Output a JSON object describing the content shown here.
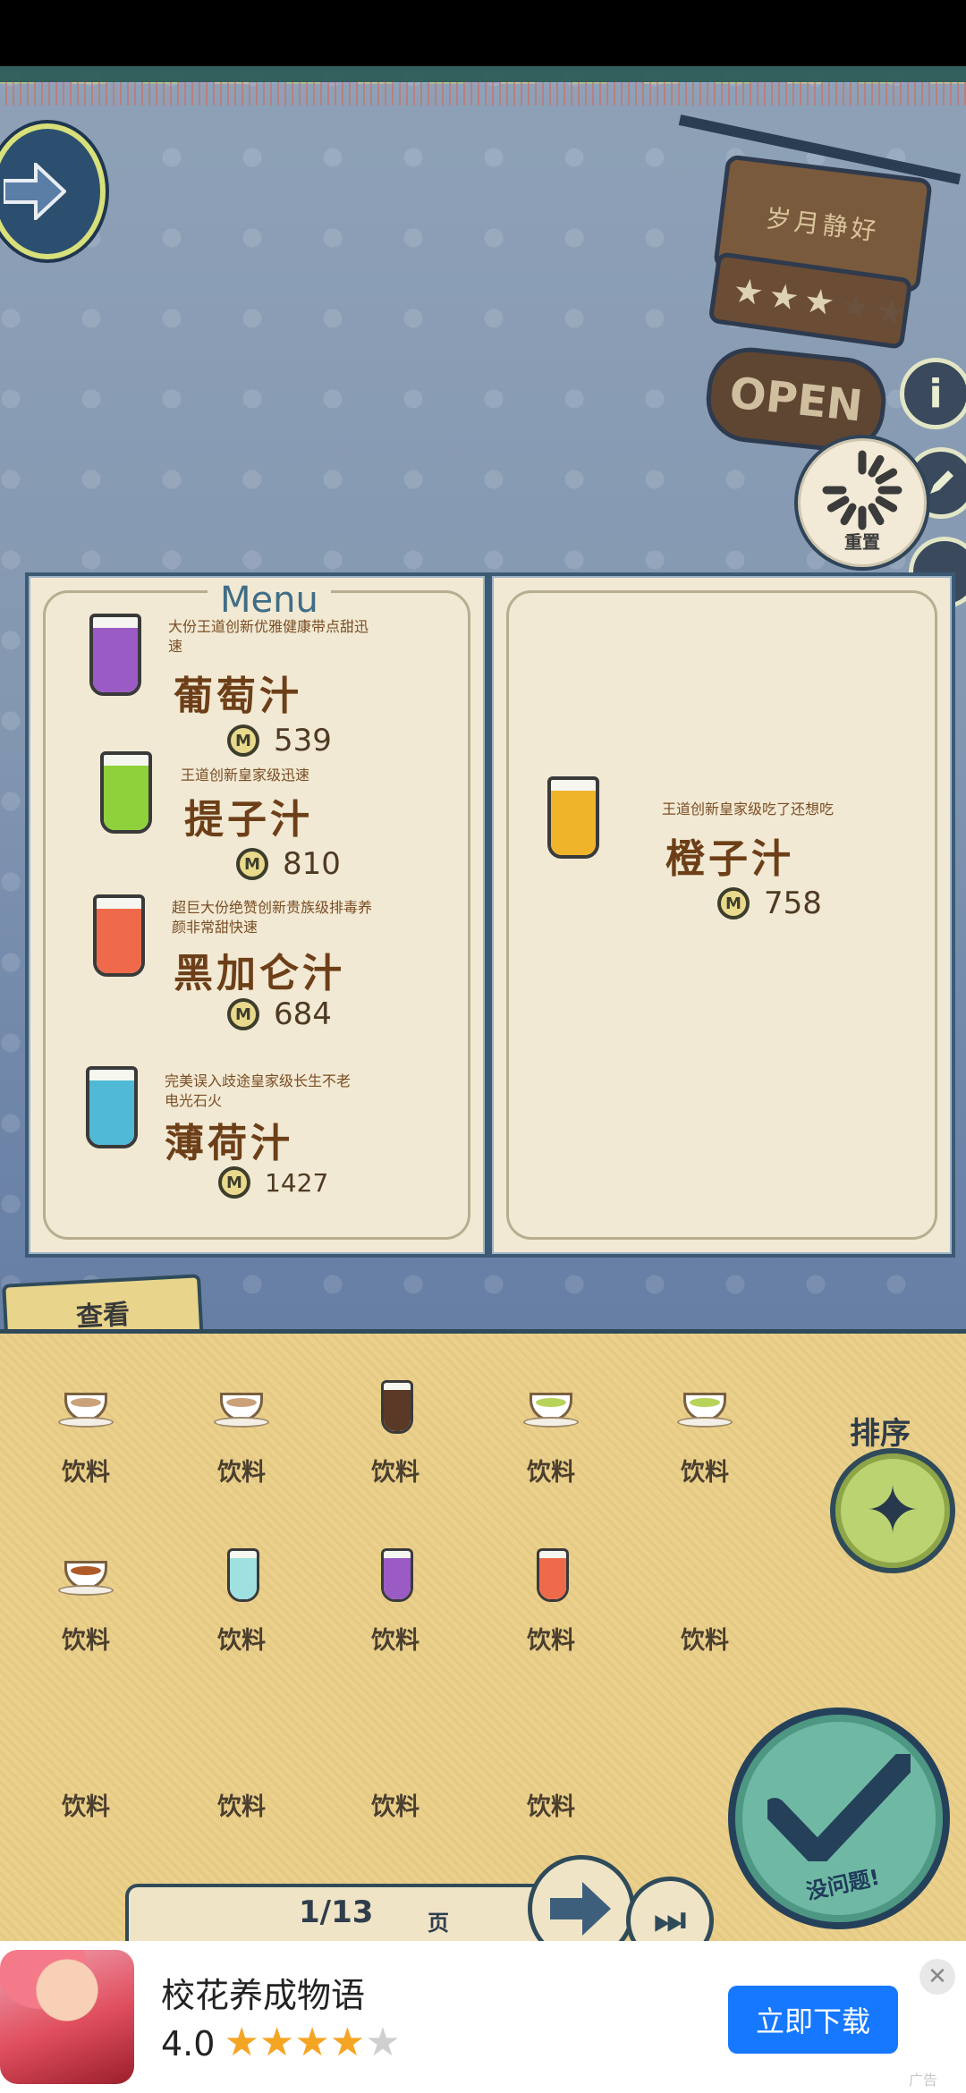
{
  "shop_sign": {
    "name": "岁月静好",
    "stars_total": 5,
    "stars_lit": 3,
    "open_label": "OPEN"
  },
  "side_buttons": {
    "info": "i"
  },
  "reset": {
    "label": "重置"
  },
  "menu": {
    "title": "Menu",
    "items": [
      {
        "desc": "大份王道创新优雅健康带点甜迅速",
        "name": "葡萄汁",
        "price": "539",
        "color": "#9b5bc5"
      },
      {
        "desc": "王道创新皇家级迅速",
        "name": "提子汁",
        "price": "810",
        "color": "#8fd13a"
      },
      {
        "desc": "超巨大份绝赞创新贵族级排毒养颜非常甜快速",
        "name": "黑加仑汁",
        "price": "684",
        "color": "#ef6a4a"
      },
      {
        "desc": "完美误入歧途皇家级长生不老电光石火",
        "name": "薄荷汁",
        "price": "1427",
        "color": "#4fb9d6"
      },
      {
        "desc": "王道创新皇家级吃了还想吃",
        "name": "橙子汁",
        "price": "758",
        "color": "#f0b42a"
      }
    ]
  },
  "view_tab": {
    "label": "查看"
  },
  "inventory": {
    "rows": [
      [
        {
          "label": "饮料",
          "icon": "coffee-cup-icon",
          "color": "#caa27a"
        },
        {
          "label": "饮料",
          "icon": "coffee-cup-icon",
          "color": "#caa27a"
        },
        {
          "label": "饮料",
          "icon": "glass-icon",
          "color": "#5a3a26"
        },
        {
          "label": "饮料",
          "icon": "green-tea-cup-icon",
          "color": "#b7d35a"
        },
        {
          "label": "饮料",
          "icon": "green-tea-cup-icon",
          "color": "#b7d35a"
        }
      ],
      [
        {
          "label": "饮料",
          "icon": "tea-cup-icon",
          "color": "#b05a2a"
        },
        {
          "label": "饮料",
          "icon": "glass-icon",
          "color": "#9fe0e0"
        },
        {
          "label": "饮料",
          "icon": "glass-icon",
          "color": "#9b5bc5"
        },
        {
          "label": "饮料",
          "icon": "glass-icon",
          "color": "#ef6a4a"
        },
        {
          "label": "饮料",
          "icon": "",
          "color": ""
        }
      ],
      [
        {
          "label": "饮料",
          "icon": "",
          "color": ""
        },
        {
          "label": "饮料",
          "icon": "",
          "color": ""
        },
        {
          "label": "饮料",
          "icon": "",
          "color": ""
        },
        {
          "label": "饮料",
          "icon": "",
          "color": ""
        }
      ]
    ]
  },
  "sort": {
    "label": "排序"
  },
  "confirm": {
    "label": "没问题!"
  },
  "pager": {
    "text": "1/13",
    "unit": "页"
  },
  "ad": {
    "title": "校花养成物语",
    "rating": "4.0",
    "stars_lit": 4,
    "stars_total": 5,
    "button": "立即下载",
    "close": "✕",
    "tag": "广告"
  }
}
